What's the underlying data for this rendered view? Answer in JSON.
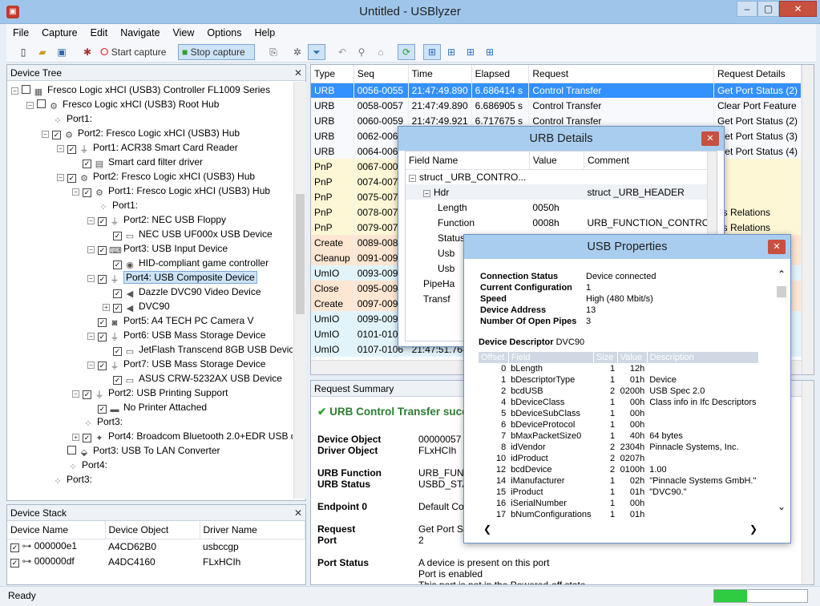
{
  "window": {
    "title": "Untitled - USBlyzer"
  },
  "menu": [
    "File",
    "Capture",
    "Edit",
    "Navigate",
    "View",
    "Options",
    "Help"
  ],
  "toolbar": {
    "start_capture": "Start capture",
    "stop_capture": "Stop capture"
  },
  "device_tree": {
    "title": "Device Tree",
    "nodes": [
      {
        "label": "Fresco Logic xHCI (USB3) Controller FL1009 Series",
        "icon": "controller-icon",
        "depth": 0,
        "expand": "−",
        "cb": true,
        "checked": false
      },
      {
        "label": "Fresco Logic xHCI (USB3) Root Hub",
        "icon": "hub-icon",
        "depth": 1,
        "expand": "−",
        "cb": true,
        "checked": false
      },
      {
        "label": "Port1:",
        "icon": "empty-port-icon",
        "depth": 2,
        "expand": "",
        "cb": false,
        "checked": false
      },
      {
        "label": "Port2: Fresco Logic xHCI (USB3) Hub",
        "icon": "hub-icon",
        "depth": 2,
        "expand": "−",
        "cb": true,
        "checked": true
      },
      {
        "label": "Port1: ACR38 Smart Card Reader",
        "icon": "usb-plug-icon",
        "depth": 3,
        "expand": "−",
        "cb": true,
        "checked": true
      },
      {
        "label": "Smart card filter driver",
        "icon": "driver-icon",
        "depth": 4,
        "expand": "",
        "cb": true,
        "checked": true
      },
      {
        "label": "Port2: Fresco Logic xHCI (USB3) Hub",
        "icon": "hub-icon",
        "depth": 3,
        "expand": "−",
        "cb": true,
        "checked": true
      },
      {
        "label": "Port1: Fresco Logic xHCI (USB3) Hub",
        "icon": "hub-icon",
        "depth": 4,
        "expand": "−",
        "cb": true,
        "checked": true
      },
      {
        "label": "Port1:",
        "icon": "empty-port-icon",
        "depth": 5,
        "expand": "",
        "cb": false,
        "checked": false
      },
      {
        "label": "Port2: NEC USB Floppy",
        "icon": "usb-plug-icon",
        "depth": 5,
        "expand": "−",
        "cb": true,
        "checked": true
      },
      {
        "label": "NEC USB UF000x USB Device",
        "icon": "disk-icon",
        "depth": 6,
        "expand": "",
        "cb": true,
        "checked": true
      },
      {
        "label": "Port3: USB Input Device",
        "icon": "keyboard-icon",
        "depth": 5,
        "expand": "−",
        "cb": true,
        "checked": true
      },
      {
        "label": "HID-compliant game controller",
        "icon": "gamepad-icon",
        "depth": 6,
        "expand": "",
        "cb": true,
        "checked": true
      },
      {
        "label": "Port4: USB Composite Device",
        "icon": "usb-plug-icon",
        "depth": 5,
        "expand": "−",
        "cb": true,
        "checked": true,
        "selected": true
      },
      {
        "label": "Dazzle DVC90 Video Device",
        "icon": "speaker-icon",
        "depth": 6,
        "expand": "",
        "cb": true,
        "checked": true
      },
      {
        "label": "DVC90",
        "icon": "speaker-icon",
        "depth": 6,
        "expand": "+",
        "cb": true,
        "checked": true
      },
      {
        "label": "Port5: A4 TECH PC Camera V",
        "icon": "camera-icon",
        "depth": 5,
        "expand": "",
        "cb": true,
        "checked": true
      },
      {
        "label": "Port6: USB Mass Storage Device",
        "icon": "usb-plug-icon",
        "depth": 5,
        "expand": "−",
        "cb": true,
        "checked": true
      },
      {
        "label": "JetFlash Transcend 8GB USB Device",
        "icon": "disk-icon",
        "depth": 6,
        "expand": "",
        "cb": true,
        "checked": true
      },
      {
        "label": "Port7: USB Mass Storage Device",
        "icon": "usb-plug-icon",
        "depth": 5,
        "expand": "−",
        "cb": true,
        "checked": true
      },
      {
        "label": "ASUS CRW-5232AX USB Device",
        "icon": "disk-icon",
        "depth": 6,
        "expand": "",
        "cb": true,
        "checked": true
      },
      {
        "label": "Port2: USB Printing Support",
        "icon": "usb-plug-icon",
        "depth": 4,
        "expand": "−",
        "cb": true,
        "checked": true
      },
      {
        "label": "No Printer Attached",
        "icon": "printer-icon",
        "depth": 5,
        "expand": "",
        "cb": true,
        "checked": true
      },
      {
        "label": "Port3:",
        "icon": "empty-port-icon",
        "depth": 4,
        "expand": "",
        "cb": false,
        "checked": false
      },
      {
        "label": "Port4: Broadcom Bluetooth 2.0+EDR USB d",
        "icon": "bluetooth-icon",
        "depth": 4,
        "expand": "+",
        "cb": true,
        "checked": true
      },
      {
        "label": "Port3: USB To LAN Converter",
        "icon": "network-icon",
        "depth": 3,
        "expand": "",
        "cb": true,
        "checked": false
      },
      {
        "label": "Port4:",
        "icon": "empty-port-icon",
        "depth": 3,
        "expand": "",
        "cb": false,
        "checked": false
      },
      {
        "label": "Port3:",
        "icon": "empty-port-icon",
        "depth": 2,
        "expand": "",
        "cb": false,
        "checked": false
      }
    ]
  },
  "device_stack": {
    "title": "Device Stack",
    "columns": [
      "Device Name",
      "Device Object",
      "Driver Name"
    ],
    "rows": [
      {
        "name": "000000e1",
        "object": "A4CD62B0",
        "driver": "usbccgp"
      },
      {
        "name": "000000df",
        "object": "A4DC4160",
        "driver": "FLxHCIh"
      }
    ]
  },
  "urb_list": {
    "columns": [
      "Type",
      "Seq",
      "Time",
      "Elapsed",
      "Request",
      "Request Details"
    ],
    "rows": [
      {
        "type": "URB",
        "seq": "0056-0055",
        "time": "21:47:49.890",
        "elapsed": "6.686414 s",
        "request": "Control Transfer",
        "details": "Get Port Status (2)",
        "cls": "c-urb",
        "selected": true
      },
      {
        "type": "URB",
        "seq": "0058-0057",
        "time": "21:47:49.890",
        "elapsed": "6.686905 s",
        "request": "Control Transfer",
        "details": "Clear Port Feature",
        "cls": "c-urb"
      },
      {
        "type": "URB",
        "seq": "0060-0059",
        "time": "21:47:49.921",
        "elapsed": "6.717675 s",
        "request": "Control Transfer",
        "details": "Get Port Status (2)",
        "cls": "c-urb"
      },
      {
        "type": "URB",
        "seq": "0062-0061",
        "time": "",
        "elapsed": "",
        "request": "",
        "details": "Get Port Status (3)",
        "cls": "c-urb"
      },
      {
        "type": "URB",
        "seq": "0064-0063",
        "time": "",
        "elapsed": "",
        "request": "",
        "details": "Get Port Status (4)",
        "cls": "c-urb"
      },
      {
        "type": "PnP",
        "seq": "0067-0002",
        "time": "",
        "elapsed": "",
        "request": "",
        "details": "",
        "cls": "c-pnp"
      },
      {
        "type": "PnP",
        "seq": "0074-0073",
        "time": "",
        "elapsed": "",
        "request": "",
        "details": "",
        "cls": "c-pnp"
      },
      {
        "type": "PnP",
        "seq": "0075-0074",
        "time": "",
        "elapsed": "",
        "request": "",
        "details": "",
        "cls": "c-pnp"
      },
      {
        "type": "PnP",
        "seq": "0078-0077",
        "time": "",
        "elapsed": "",
        "request": "",
        "details": "us Relations",
        "cls": "c-pnp"
      },
      {
        "type": "PnP",
        "seq": "0079-0076",
        "time": "",
        "elapsed": "",
        "request": "",
        "details": "us Relations",
        "cls": "c-pnp"
      },
      {
        "type": "Create",
        "seq": "0089-0088",
        "time": "",
        "elapsed": "",
        "request": "",
        "details": "",
        "cls": "c-create"
      },
      {
        "type": "Cleanup",
        "seq": "0091-0090",
        "time": "",
        "elapsed": "",
        "request": "",
        "details": "",
        "cls": "c-cleanup"
      },
      {
        "type": "UmIO",
        "seq": "0093-0092",
        "time": "",
        "elapsed": "",
        "request": "",
        "details": "",
        "cls": "c-umio"
      },
      {
        "type": "Close",
        "seq": "0095-0094",
        "time": "",
        "elapsed": "",
        "request": "",
        "details": "",
        "cls": "c-close"
      },
      {
        "type": "Create",
        "seq": "0097-0096",
        "time": "",
        "elapsed": "",
        "request": "",
        "details": "",
        "cls": "c-create"
      },
      {
        "type": "UmIO",
        "seq": "0099-0098",
        "time": "",
        "elapsed": "",
        "request": "",
        "details": "",
        "cls": "c-umio"
      },
      {
        "type": "UmIO",
        "seq": "0101-0100",
        "time": "",
        "elapsed": "",
        "request": "",
        "details": "",
        "cls": "c-umio"
      },
      {
        "type": "UmIO",
        "seq": "0107-0106",
        "time": "21:47:51.764",
        "elapsed": "",
        "request": "",
        "details": "",
        "cls": "c-umio"
      }
    ]
  },
  "request_summary": {
    "title": "Request Summary",
    "heading": "URB Control Transfer succ",
    "rows": [
      {
        "label": "Device Object",
        "value": "00000057"
      },
      {
        "label": "Driver Object",
        "value": "FLxHCIh"
      },
      {
        "label": "URB Function",
        "value": "URB_FUNCT"
      },
      {
        "label": "URB Status",
        "value": "USBD_STAT"
      },
      {
        "label": "Endpoint 0",
        "value": "Default Con"
      },
      {
        "label": "Request",
        "value": "Get Port Stat"
      },
      {
        "label": "Port",
        "value": "2"
      },
      {
        "label": "Port Status",
        "value": "A device is present on this port"
      }
    ],
    "extra": [
      "Port is enabled",
      "This port is not in the Powered-off state"
    ]
  },
  "urb_details": {
    "title": "URB Details",
    "columns": [
      "Field Name",
      "Value",
      "Comment"
    ],
    "rows": [
      {
        "name": "struct _URB_CONTRO...",
        "value": "",
        "comment": "",
        "indent": 0,
        "expand": "−"
      },
      {
        "name": "Hdr",
        "value": "",
        "comment": "struct _URB_HEADER",
        "indent": 1,
        "expand": "−",
        "shade": true
      },
      {
        "name": "Length",
        "value": "0050h",
        "comment": "",
        "indent": 2,
        "expand": ""
      },
      {
        "name": "Function",
        "value": "0008h",
        "comment": "URB_FUNCTION_CONTROL_",
        "indent": 2,
        "expand": ""
      },
      {
        "name": "Status",
        "value": "00000000h",
        "comment": "USBD_STATUS_SUCCESS",
        "indent": 2,
        "expand": ""
      },
      {
        "name": "Usb",
        "value": "",
        "comment": "",
        "indent": 2,
        "expand": ""
      },
      {
        "name": "Usb",
        "value": "",
        "comment": "",
        "indent": 2,
        "expand": ""
      },
      {
        "name": "PipeHa",
        "value": "",
        "comment": "",
        "indent": 1,
        "expand": ""
      },
      {
        "name": "Transf",
        "value": "",
        "comment": "",
        "indent": 1,
        "expand": ""
      }
    ]
  },
  "usb_properties": {
    "title": "USB Properties",
    "info": [
      {
        "label": "Connection Status",
        "value": "Device connected"
      },
      {
        "label": "Current Configuration",
        "value": "1"
      },
      {
        "label": "Speed",
        "value": "High (480 Mbit/s)"
      },
      {
        "label": "Device Address",
        "value": "13"
      },
      {
        "label": "Number Of Open Pipes",
        "value": "3"
      }
    ],
    "descriptor_label": "Device Descriptor",
    "descriptor_name": "DVC90",
    "columns": [
      "Offset",
      "Field",
      "Size",
      "Value",
      "Description"
    ],
    "rows": [
      {
        "offset": "0",
        "field": "bLength",
        "size": "1",
        "value": "12h",
        "desc": ""
      },
      {
        "offset": "1",
        "field": "bDescriptorType",
        "size": "1",
        "value": "01h",
        "desc": "Device"
      },
      {
        "offset": "2",
        "field": "bcdUSB",
        "size": "2",
        "value": "0200h",
        "desc": "USB Spec 2.0"
      },
      {
        "offset": "4",
        "field": "bDeviceClass",
        "size": "1",
        "value": "00h",
        "desc": "Class info in Ifc Descriptors"
      },
      {
        "offset": "5",
        "field": "bDeviceSubClass",
        "size": "1",
        "value": "00h",
        "desc": ""
      },
      {
        "offset": "6",
        "field": "bDeviceProtocol",
        "size": "1",
        "value": "00h",
        "desc": ""
      },
      {
        "offset": "7",
        "field": "bMaxPacketSize0",
        "size": "1",
        "value": "40h",
        "desc": "64 bytes"
      },
      {
        "offset": "8",
        "field": "idVendor",
        "size": "2",
        "value": "2304h",
        "desc": "Pinnacle Systems, Inc."
      },
      {
        "offset": "10",
        "field": "idProduct",
        "size": "2",
        "value": "0207h",
        "desc": ""
      },
      {
        "offset": "12",
        "field": "bcdDevice",
        "size": "2",
        "value": "0100h",
        "desc": "1.00"
      },
      {
        "offset": "14",
        "field": "iManufacturer",
        "size": "1",
        "value": "02h",
        "desc": "\"Pinnacle Systems GmbH.\""
      },
      {
        "offset": "15",
        "field": "iProduct",
        "size": "1",
        "value": "01h",
        "desc": "\"DVC90.\""
      },
      {
        "offset": "16",
        "field": "iSerialNumber",
        "size": "1",
        "value": "00h",
        "desc": ""
      },
      {
        "offset": "17",
        "field": "bNumConfigurations",
        "size": "1",
        "value": "01h",
        "desc": ""
      }
    ]
  },
  "status": {
    "text": "Ready",
    "progress": 0.35
  },
  "colors": {
    "accent": "#3390ff",
    "titlebar": "#9fc6ea",
    "success": "#2e9e2e"
  }
}
